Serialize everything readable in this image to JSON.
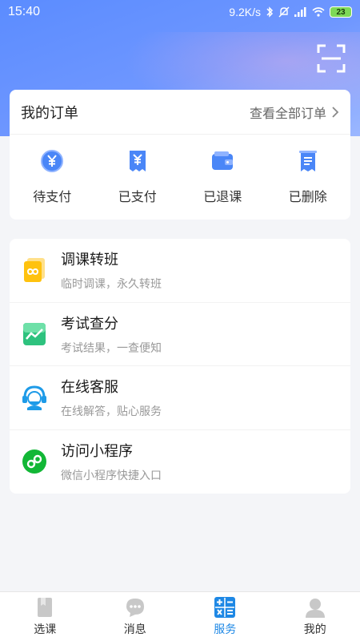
{
  "status_bar": {
    "time": "15:40",
    "network_speed": "9.2K/s",
    "battery": "23"
  },
  "header": {
    "scan_icon": "scan-icon"
  },
  "orders": {
    "title": "我的订单",
    "view_all": "查看全部订单",
    "items": [
      {
        "label": "待支付",
        "icon": "yen-coin-icon"
      },
      {
        "label": "已支付",
        "icon": "yen-receipt-icon"
      },
      {
        "label": "已退课",
        "icon": "wallet-icon"
      },
      {
        "label": "已删除",
        "icon": "list-receipt-icon"
      }
    ]
  },
  "services": [
    {
      "title": "调课转班",
      "subtitle": "临时调课，永久转班",
      "icon": "infinity-icon"
    },
    {
      "title": "考试查分",
      "subtitle": "考试结果，一查便知",
      "icon": "trend-chart-icon"
    },
    {
      "title": "在线客服",
      "subtitle": "在线解答，贴心服务",
      "icon": "headset-agent-icon"
    },
    {
      "title": "访问小程序",
      "subtitle": "微信小程序快捷入口",
      "icon": "mini-program-icon"
    }
  ],
  "bottom_nav": [
    {
      "label": "选课",
      "active": false
    },
    {
      "label": "消息",
      "active": false
    },
    {
      "label": "服务",
      "active": true
    },
    {
      "label": "我的",
      "active": false
    }
  ],
  "colors": {
    "accent": "#1e88e5",
    "header_blue": "#5b8cff",
    "order_icon_blue": "#4a86f7"
  }
}
